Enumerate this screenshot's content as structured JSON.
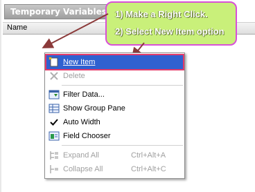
{
  "panel": {
    "title": "Temporary Variables",
    "column_name": "Name"
  },
  "callout": {
    "line1": "1) Make a Right Click.",
    "line2": "2) Select New Item option"
  },
  "menu": {
    "items": [
      {
        "label": "New Item",
        "shortcut": "",
        "enabled": true,
        "selected": true,
        "icon": "new-document-icon"
      },
      {
        "label": "Delete",
        "shortcut": "",
        "enabled": false,
        "selected": false,
        "icon": "delete-x-icon"
      },
      {
        "label": "Filter Data...",
        "shortcut": "",
        "enabled": true,
        "selected": false,
        "icon": "filter-icon"
      },
      {
        "label": "Show Group Pane",
        "shortcut": "",
        "enabled": true,
        "selected": false,
        "icon": "group-pane-icon"
      },
      {
        "label": "Auto Width",
        "shortcut": "",
        "enabled": true,
        "selected": false,
        "icon": "checkmark-icon"
      },
      {
        "label": "Field Chooser",
        "shortcut": "",
        "enabled": true,
        "selected": false,
        "icon": "field-chooser-icon"
      },
      {
        "label": "Expand All",
        "shortcut": "Ctrl+Alt+A",
        "enabled": false,
        "selected": false,
        "icon": "expand-all-icon"
      },
      {
        "label": "Collapse All",
        "shortcut": "Ctrl+Alt+C",
        "enabled": false,
        "selected": false,
        "icon": "collapse-all-icon"
      }
    ]
  },
  "colors": {
    "callout_fill": "#c9f07a",
    "callout_border": "#d84fd8",
    "arrow": "#8b3a3a",
    "selection": "#2f61d0",
    "highlight_border": "#e23a6a"
  }
}
